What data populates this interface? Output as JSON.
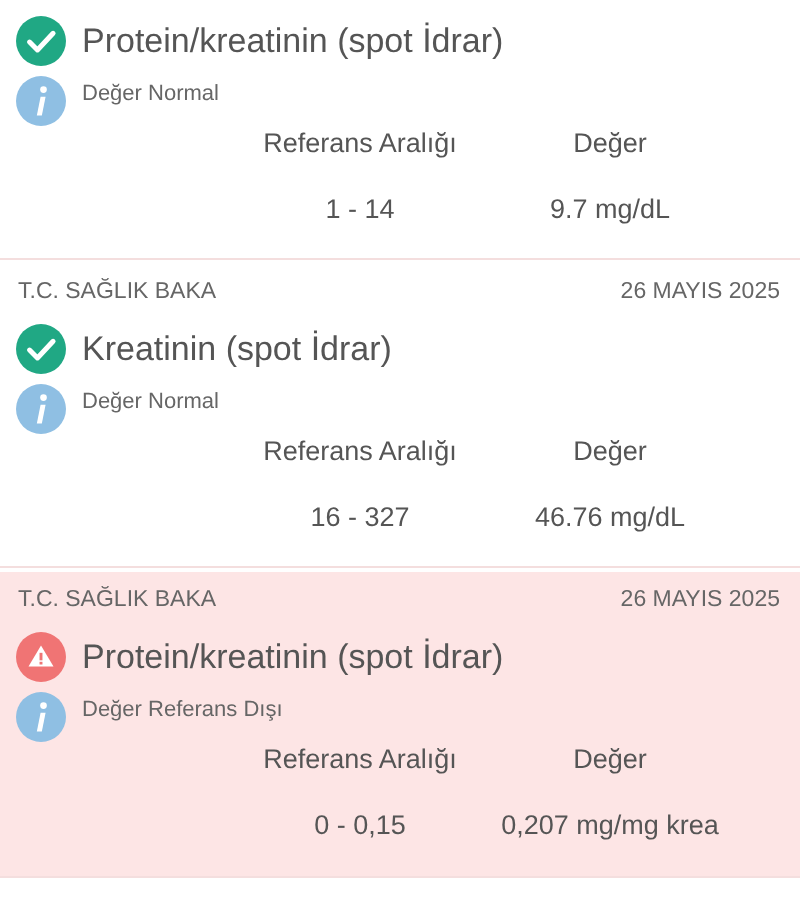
{
  "results": [
    {
      "kind": "normal",
      "title": "Protein/kreatinin (spot İdrar)",
      "note": "Değer Normal",
      "range_label": "Referans Aralığı",
      "value_label": "Değer",
      "range": "1 - 14",
      "value": "9.7 mg/dL"
    },
    {
      "header": {
        "institution": "T.C. SAĞLIK BAKA",
        "date": "26 MAYIS 2025"
      },
      "kind": "normal",
      "title": "Kreatinin (spot İdrar)",
      "note": "Değer Normal",
      "range_label": "Referans Aralığı",
      "value_label": "Değer",
      "range": "16 - 327",
      "value": "46.76 mg/dL"
    },
    {
      "header": {
        "institution": "T.C. SAĞLIK BAKA",
        "date": "26 MAYIS 2025"
      },
      "kind": "abnormal",
      "title": "Protein/kreatinin (spot İdrar)",
      "note": "Değer Referans Dışı",
      "range_label": "Referans Aralığı",
      "value_label": "Değer",
      "range": "0 - 0,15",
      "value": "0,207 mg/mg krea"
    }
  ]
}
